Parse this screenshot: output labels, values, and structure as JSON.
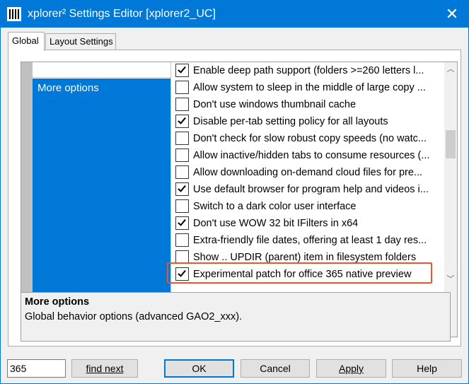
{
  "window": {
    "title": "xplorer² Settings Editor [xplorer2_UC]",
    "close_glyph": "✕",
    "accent_color": "#0078d7"
  },
  "tabs": [
    {
      "label": "Global",
      "active": true
    },
    {
      "label": "Layout Settings",
      "active": false
    }
  ],
  "category": {
    "selected_label": "More options"
  },
  "options": [
    {
      "label": "Enable deep path support (folders >=260 letters l...",
      "checked": true
    },
    {
      "label": "Allow system to sleep in the middle of large copy ...",
      "checked": false
    },
    {
      "label": "Don't use windows thumbnail cache",
      "checked": false
    },
    {
      "label": "Disable per-tab setting policy for all layouts",
      "checked": true
    },
    {
      "label": "Don't check for slow robust copy speeds (no watc...",
      "checked": false
    },
    {
      "label": "Allow inactive/hidden tabs to consume resources (...",
      "checked": false
    },
    {
      "label": "Allow downloading on-demand cloud files for pre...",
      "checked": false
    },
    {
      "label": "Use default browser for program help and videos i...",
      "checked": true
    },
    {
      "label": "Switch to a dark color user interface",
      "checked": false
    },
    {
      "label": "Don't use WOW 32 bit IFilters in x64",
      "checked": true
    },
    {
      "label": "Extra-friendly file dates, offering at least 1 day res...",
      "checked": false
    },
    {
      "label": "Show .. UPDIR (parent) item in filesystem folders",
      "checked": false
    },
    {
      "label": "Experimental patch for office 365 native preview",
      "checked": true
    }
  ],
  "description": {
    "title": "More options",
    "text": "Global behavior options (advanced GAO2_xxx)."
  },
  "bottom": {
    "find_value": "365",
    "find_next": "find next",
    "ok": "OK",
    "cancel": "Cancel",
    "apply": "Apply",
    "help": "Help"
  },
  "highlight_color": "#e8562a"
}
